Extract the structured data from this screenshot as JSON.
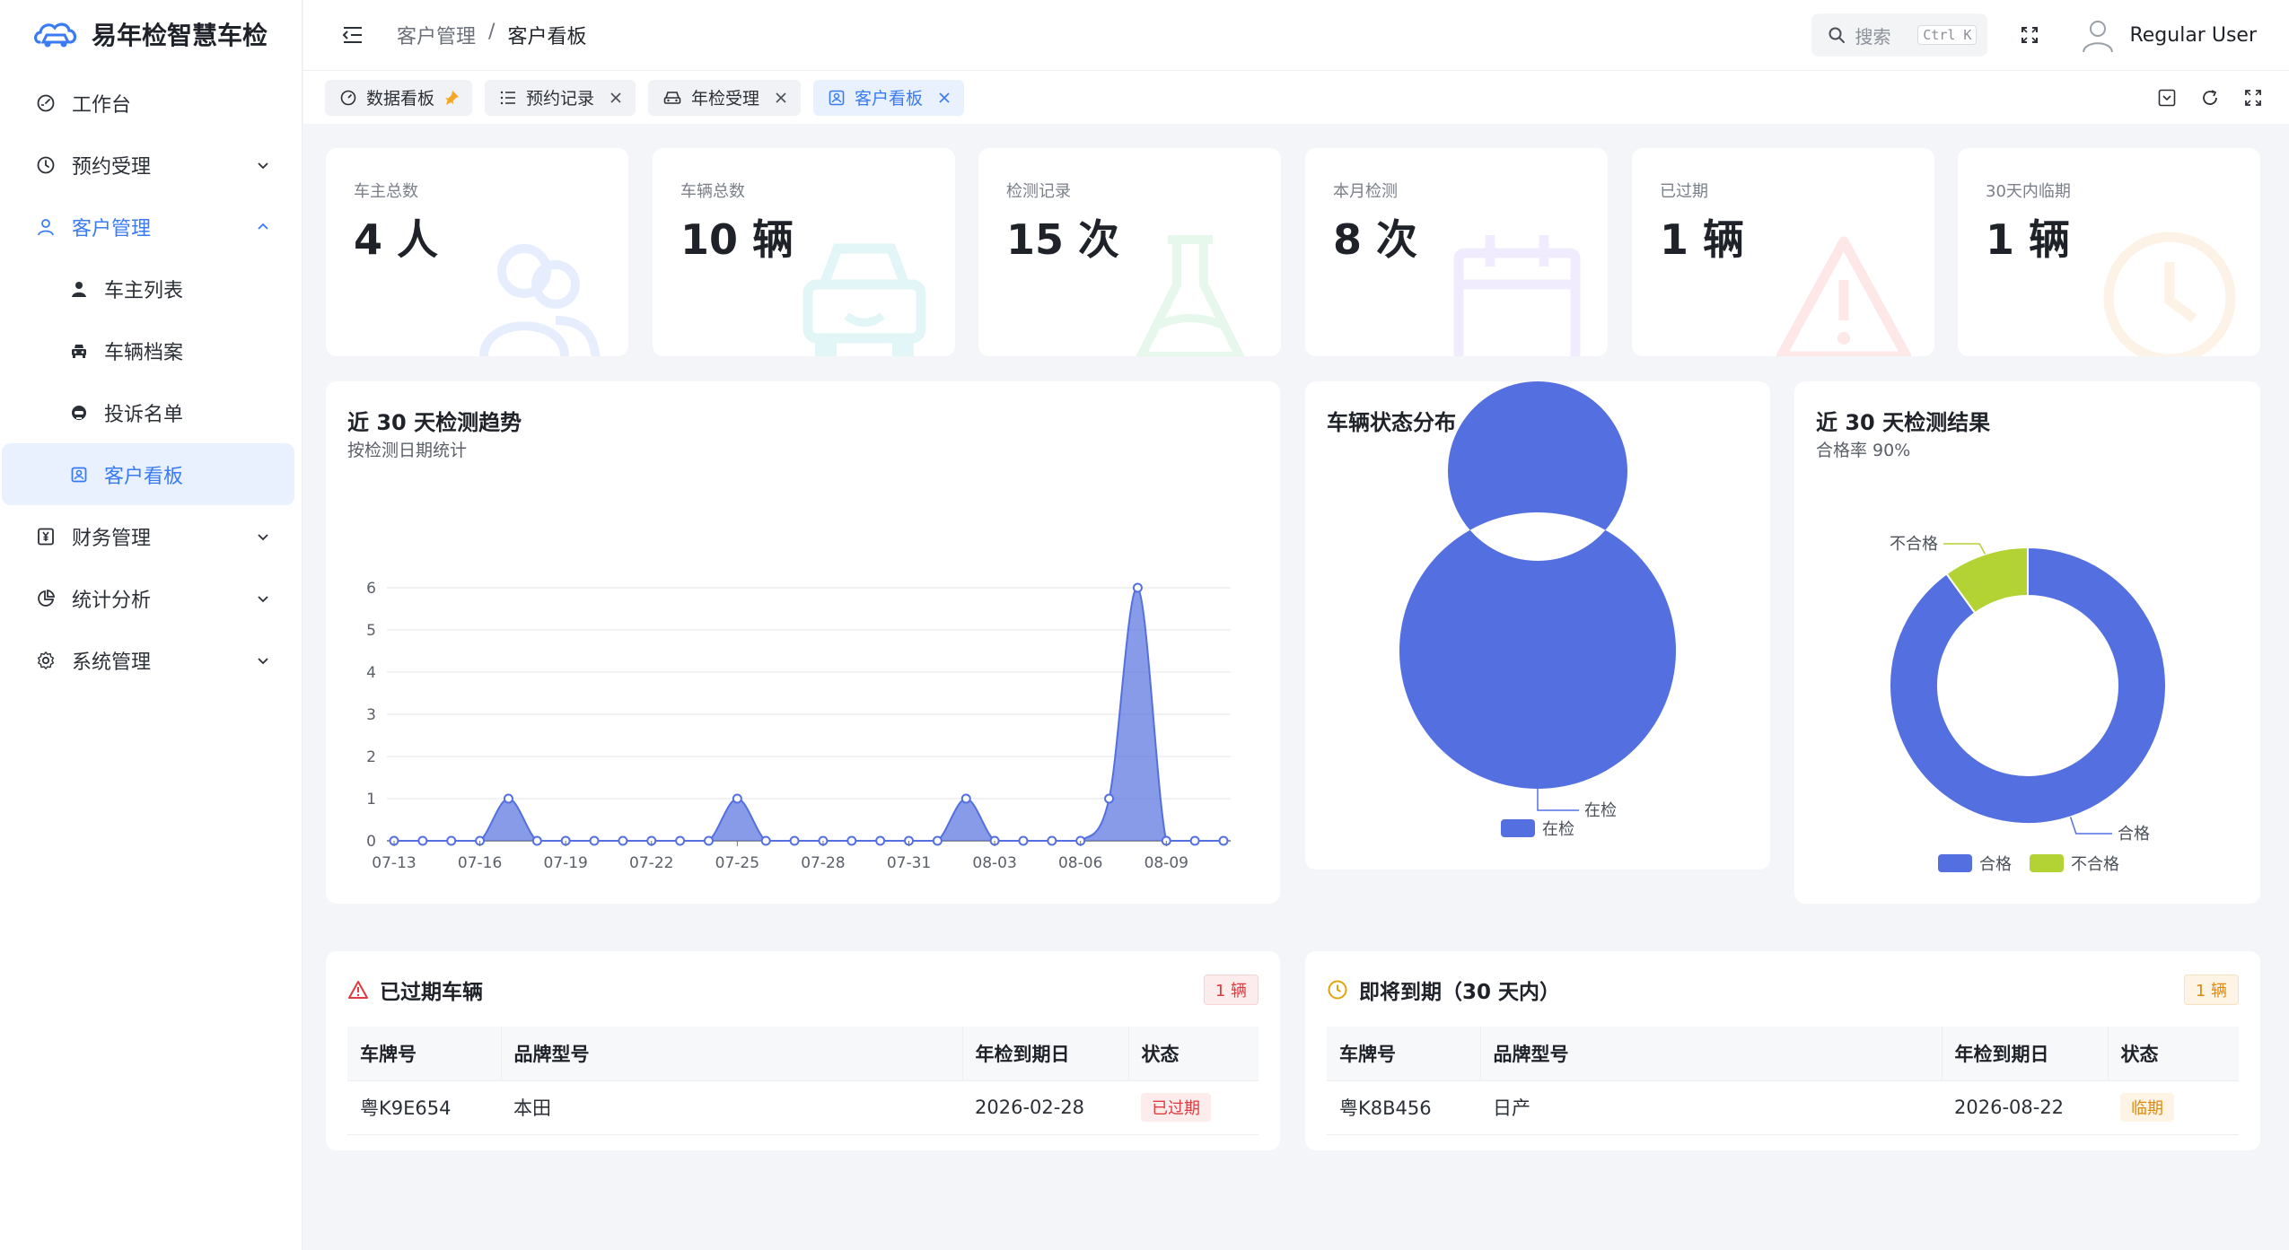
{
  "app": {
    "title": "易年检智慧车检"
  },
  "sidebar": {
    "items": [
      {
        "label": "工作台",
        "icon": "dashboard-icon"
      },
      {
        "label": "预约受理",
        "icon": "clock-icon"
      },
      {
        "label": "客户管理",
        "icon": "user-icon",
        "expanded": true,
        "children": [
          {
            "label": "车主列表",
            "icon": "person-icon"
          },
          {
            "label": "车辆档案",
            "icon": "car-icon"
          },
          {
            "label": "投诉名单",
            "icon": "headset-icon"
          },
          {
            "label": "客户看板",
            "icon": "contact-card-icon",
            "active": true
          }
        ]
      },
      {
        "label": "财务管理",
        "icon": "yen-icon"
      },
      {
        "label": "统计分析",
        "icon": "pie-icon"
      },
      {
        "label": "系统管理",
        "icon": "gear-icon"
      }
    ]
  },
  "header": {
    "breadcrumb": [
      "客户管理",
      "/",
      "客户看板"
    ],
    "search_label": "搜索",
    "search_kbd": "Ctrl K",
    "user_name": "Regular User"
  },
  "tabs": [
    {
      "label": "数据看板",
      "icon": "gauge-icon",
      "pinned": true
    },
    {
      "label": "预约记录",
      "icon": "list-icon",
      "closable": true
    },
    {
      "label": "年检受理",
      "icon": "car-icon",
      "closable": true
    },
    {
      "label": "客户看板",
      "icon": "contact-card-icon",
      "closable": true,
      "active": true
    }
  ],
  "stats": [
    {
      "label": "车主总数",
      "value": "4 人",
      "color": "#3a7bf5",
      "icon": "users-icon"
    },
    {
      "label": "车辆总数",
      "value": "10 辆",
      "color": "#19b6c4",
      "icon": "car-icon"
    },
    {
      "label": "检测记录",
      "value": "15 次",
      "color": "#3cc466",
      "icon": "flask-icon"
    },
    {
      "label": "本月检测",
      "value": "8 次",
      "color": "#8e6cf0",
      "icon": "calendar-icon"
    },
    {
      "label": "已过期",
      "value": "1 辆",
      "color": "#ef4444",
      "icon": "warning-icon"
    },
    {
      "label": "30天内临期",
      "value": "1 辆",
      "color": "#f59a3c",
      "icon": "clock-icon"
    }
  ],
  "trend_panel": {
    "title": "近 30 天检测趋势",
    "subtitle": "按检测日期统计"
  },
  "status_panel": {
    "title": "车辆状态分布"
  },
  "result_panel": {
    "title": "近 30 天检测结果",
    "subtitle": "合格率 90%"
  },
  "chart_data": [
    {
      "type": "area",
      "title": "近 30 天检测趋势",
      "x": [
        "07-13",
        "07-14",
        "07-15",
        "07-16",
        "07-17",
        "07-18",
        "07-19",
        "07-20",
        "07-21",
        "07-22",
        "07-23",
        "07-24",
        "07-25",
        "07-26",
        "07-27",
        "07-28",
        "07-29",
        "07-30",
        "07-31",
        "08-01",
        "08-02",
        "08-03",
        "08-04",
        "08-05",
        "08-06",
        "08-07",
        "08-08",
        "08-09",
        "08-10",
        "08-11"
      ],
      "xticks": [
        "07-13",
        "07-16",
        "07-19",
        "07-22",
        "07-25",
        "07-28",
        "07-31",
        "08-03",
        "08-06",
        "08-09"
      ],
      "series": [
        {
          "values": [
            0,
            0,
            0,
            0,
            1,
            0,
            0,
            0,
            0,
            0,
            0,
            0,
            1,
            0,
            0,
            0,
            0,
            0,
            0,
            0,
            1,
            0,
            0,
            0,
            0,
            1,
            6,
            0,
            0,
            0
          ]
        }
      ],
      "ylim": [
        0,
        6
      ],
      "yticks": [
        0,
        1,
        2,
        3,
        4,
        5,
        6
      ],
      "color": "#5470e0",
      "grid": true
    },
    {
      "type": "pie",
      "title": "车辆状态分布",
      "labels": [
        "在检"
      ],
      "values": [
        1
      ],
      "colors": [
        "#5470e0"
      ],
      "legend": "bottom"
    },
    {
      "type": "pie",
      "title": "近 30 天检测结果",
      "labels": [
        "合格",
        "不合格"
      ],
      "values": [
        90,
        10
      ],
      "colors": [
        "#5470e0",
        "#b3d234"
      ],
      "legend": "bottom"
    }
  ],
  "expired": {
    "title": "已过期车辆",
    "count": "1 辆",
    "columns": [
      "车牌号",
      "品牌型号",
      "年检到期日",
      "状态"
    ],
    "rows": [
      {
        "plate": "粤K9E654",
        "brand": "本田",
        "due": "2026-02-28",
        "status": "已过期"
      }
    ]
  },
  "upcoming": {
    "title": "即将到期（30 天内）",
    "count": "1 辆",
    "columns": [
      "车牌号",
      "品牌型号",
      "年检到期日",
      "状态"
    ],
    "rows": [
      {
        "plate": "粤K8B456",
        "brand": "日产",
        "due": "2026-08-22",
        "status": "临期"
      }
    ]
  }
}
